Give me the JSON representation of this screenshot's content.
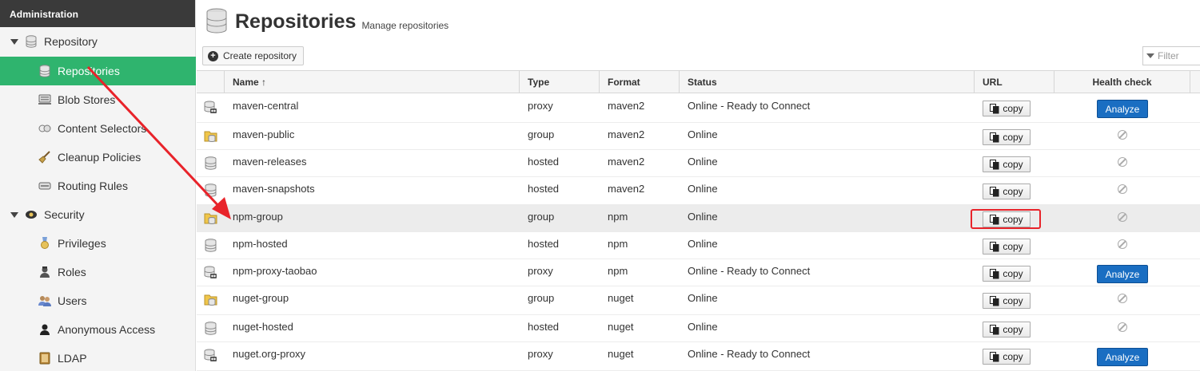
{
  "sidebar": {
    "title": "Administration",
    "items": [
      {
        "label": "Repository",
        "icon": "database-icon",
        "type": "group"
      },
      {
        "label": "Repositories",
        "icon": "database-icon",
        "type": "child",
        "selected": true
      },
      {
        "label": "Blob Stores",
        "icon": "server-icon",
        "type": "child"
      },
      {
        "label": "Content Selectors",
        "icon": "content-selector-icon",
        "type": "child"
      },
      {
        "label": "Cleanup Policies",
        "icon": "broom-icon",
        "type": "child"
      },
      {
        "label": "Routing Rules",
        "icon": "routing-icon",
        "type": "child"
      },
      {
        "label": "Security",
        "icon": "eye-icon",
        "type": "group"
      },
      {
        "label": "Privileges",
        "icon": "medal-icon",
        "type": "child"
      },
      {
        "label": "Roles",
        "icon": "role-icon",
        "type": "child"
      },
      {
        "label": "Users",
        "icon": "users-icon",
        "type": "child"
      },
      {
        "label": "Anonymous Access",
        "icon": "user-icon",
        "type": "child"
      },
      {
        "label": "LDAP",
        "icon": "ldap-book-icon",
        "type": "child"
      }
    ]
  },
  "header": {
    "title": "Repositories",
    "subtitle": "Manage repositories",
    "create_label": "Create repository",
    "filter_placeholder": "Filter"
  },
  "grid": {
    "columns": {
      "name": "Name ↑",
      "type": "Type",
      "format": "Format",
      "status": "Status",
      "url": "URL",
      "health": "Health check"
    },
    "copy_label": "copy",
    "analyze_label": "Analyze",
    "rows": [
      {
        "name": "maven-central",
        "type": "proxy",
        "format": "maven2",
        "status": "Online - Ready to Connect",
        "health": "analyze"
      },
      {
        "name": "maven-public",
        "type": "group",
        "format": "maven2",
        "status": "Online",
        "health": "none"
      },
      {
        "name": "maven-releases",
        "type": "hosted",
        "format": "maven2",
        "status": "Online",
        "health": "none"
      },
      {
        "name": "maven-snapshots",
        "type": "hosted",
        "format": "maven2",
        "status": "Online",
        "health": "none"
      },
      {
        "name": "npm-group",
        "type": "group",
        "format": "npm",
        "status": "Online",
        "health": "none",
        "highlighted": true
      },
      {
        "name": "npm-hosted",
        "type": "hosted",
        "format": "npm",
        "status": "Online",
        "health": "none"
      },
      {
        "name": "npm-proxy-taobao",
        "type": "proxy",
        "format": "npm",
        "status": "Online - Ready to Connect",
        "health": "analyze"
      },
      {
        "name": "nuget-group",
        "type": "group",
        "format": "nuget",
        "status": "Online",
        "health": "none"
      },
      {
        "name": "nuget-hosted",
        "type": "hosted",
        "format": "nuget",
        "status": "Online",
        "health": "none"
      },
      {
        "name": "nuget.org-proxy",
        "type": "proxy",
        "format": "nuget",
        "status": "Online - Ready to Connect",
        "health": "analyze"
      }
    ]
  },
  "colors": {
    "selected": "#2fb46e",
    "analyze": "#1a6ec2",
    "annotation": "#e8232a"
  }
}
